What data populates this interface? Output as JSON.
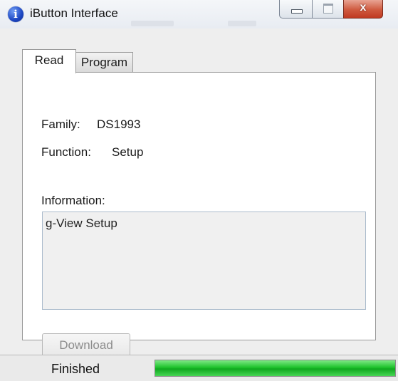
{
  "window": {
    "title": "iButton Interface",
    "icon": "info-icon",
    "icon_glyph": "i",
    "controls": {
      "minimize_icon": "minimize-icon",
      "maximize_icon": "maximize-icon",
      "close_icon": "close-icon",
      "close_glyph": "x"
    }
  },
  "tabs": [
    {
      "label": "Read",
      "selected": true
    },
    {
      "label": "Program",
      "selected": false
    }
  ],
  "read_tab": {
    "family_label": "Family:",
    "family_value": "DS1993",
    "function_label": "Function:",
    "function_value": "Setup",
    "information_label": "Information:",
    "information_text": "g-View Setup",
    "download_label": "Download",
    "download_enabled": false
  },
  "status": {
    "text": "Finished",
    "progress": 1.0,
    "progress_color": "#1fc32d"
  },
  "colors": {
    "close_button": "#c9472d",
    "title_icon": "#1c46c2"
  }
}
